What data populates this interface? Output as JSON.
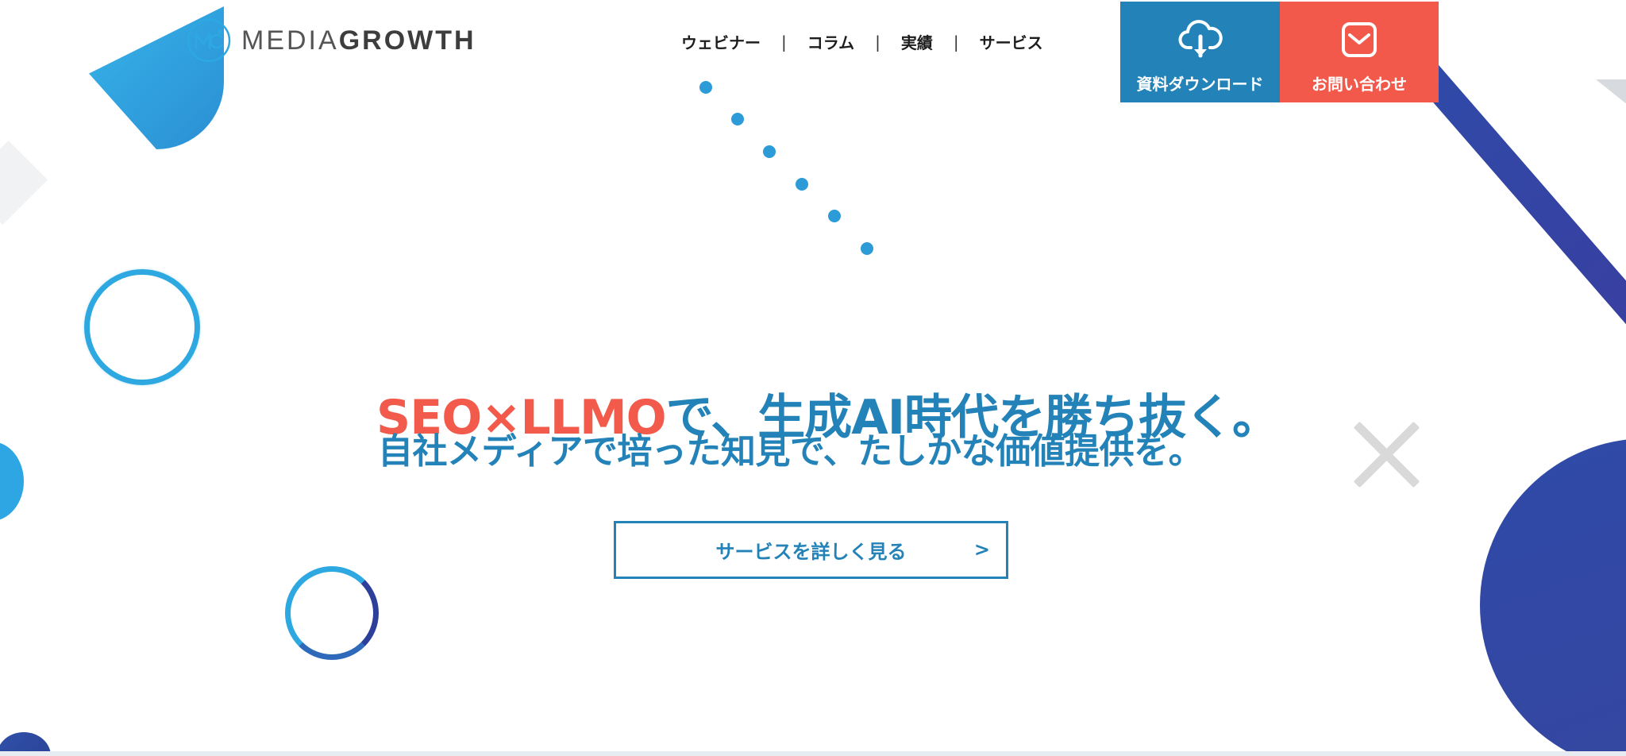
{
  "logo": {
    "text_light": "MEDIA",
    "text_bold": "GROWTH"
  },
  "nav": {
    "items": [
      {
        "label": "ウェビナー"
      },
      {
        "label": "コラム"
      },
      {
        "label": "実績"
      },
      {
        "label": "サービス"
      }
    ],
    "separator": "|"
  },
  "cta": {
    "download": {
      "label": "資料ダウンロード",
      "icon": "cloud-download-icon",
      "color": "#2383b8"
    },
    "contact": {
      "label": "お問い合わせ",
      "icon": "mail-icon",
      "color": "#f2594b"
    }
  },
  "hero": {
    "headline_accent": "SEO×LLMO",
    "headline_rest": "で、生成AI時代を勝ち抜く。",
    "subheadline": "自社メディアで培った知見で、たしかな価値提供を。",
    "button_label": "サービスを詳しく見る",
    "button_arrow": ">"
  },
  "colors": {
    "primary_blue": "#2383b8",
    "accent_red": "#f2594b",
    "light_blue": "#2ea8e1",
    "navy": "#2f4aa8"
  }
}
